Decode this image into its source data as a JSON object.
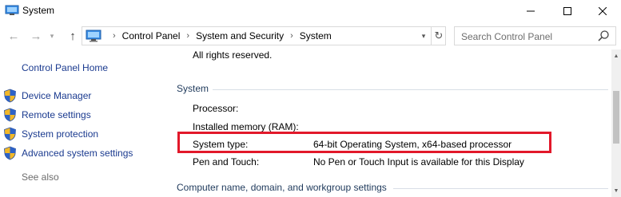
{
  "window": {
    "title": "System",
    "minimize_icon": "minimize-icon",
    "maximize_icon": "maximize-icon",
    "close_icon": "close-icon"
  },
  "nav": {
    "back_icon": "back-arrow-icon",
    "forward_icon": "forward-arrow-icon",
    "recent_icon": "chevron-down-icon",
    "up_icon": "up-arrow-icon",
    "breadcrumbs": [
      "Control Panel",
      "System and Security",
      "System"
    ],
    "refresh_icon": "refresh-icon",
    "search_placeholder": "Search Control Panel"
  },
  "sidebar": {
    "home": "Control Panel Home",
    "items": [
      {
        "label": "Device Manager",
        "icon": "shield-icon"
      },
      {
        "label": "Remote settings",
        "icon": "shield-icon"
      },
      {
        "label": "System protection",
        "icon": "shield-icon"
      },
      {
        "label": "Advanced system settings",
        "icon": "shield-icon"
      }
    ],
    "see_also": "See also"
  },
  "main": {
    "rights": "All rights reserved.",
    "system_section": {
      "heading": "System",
      "rows": [
        {
          "label": "Processor:",
          "value": ""
        },
        {
          "label": "Installed memory (RAM):",
          "value": ""
        },
        {
          "label": "System type:",
          "value": "64-bit Operating System, x64-based processor"
        },
        {
          "label": "Pen and Touch:",
          "value": "No Pen or Touch Input is available for this Display"
        }
      ]
    },
    "computer_section": {
      "heading": "Computer name, domain, and workgroup settings"
    }
  },
  "colors": {
    "link": "#1a3a8f",
    "section_heading": "#1e395b",
    "highlight": "#e2182a"
  }
}
